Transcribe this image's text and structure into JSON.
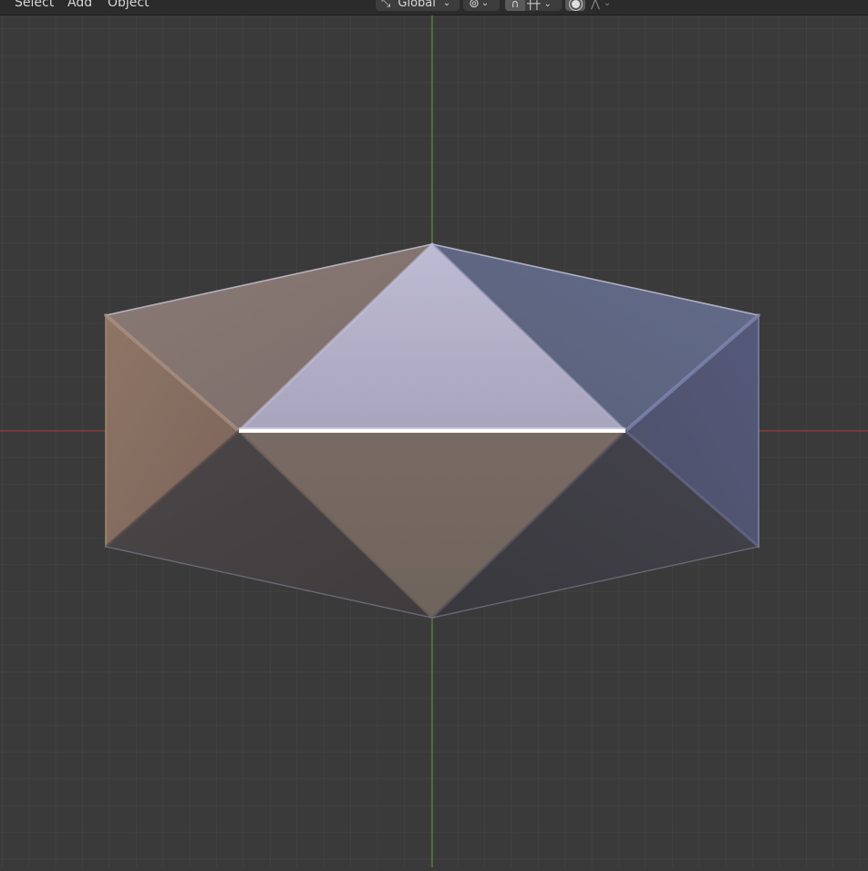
{
  "header": {
    "menu": {
      "select": "Select",
      "add": "Add",
      "object": "Object"
    },
    "transform_orientation": {
      "value": "Global",
      "icon": "orientation-axes-icon"
    },
    "pivot": {
      "icon": "pivot-point-icon"
    },
    "snapping": {
      "toggle_icon": "magnet-icon",
      "type_icon": "snap-increment-icon"
    },
    "proportional_editing": {
      "icon": "proportional-edit-icon",
      "falloff_icon": "falloff-curve-icon"
    }
  },
  "viewport": {
    "background_color": "#3a3a3a",
    "x_axis_color": "#a3423f",
    "y_axis_color": "#6b9a2e",
    "object": "icosphere-like polyhedron"
  }
}
